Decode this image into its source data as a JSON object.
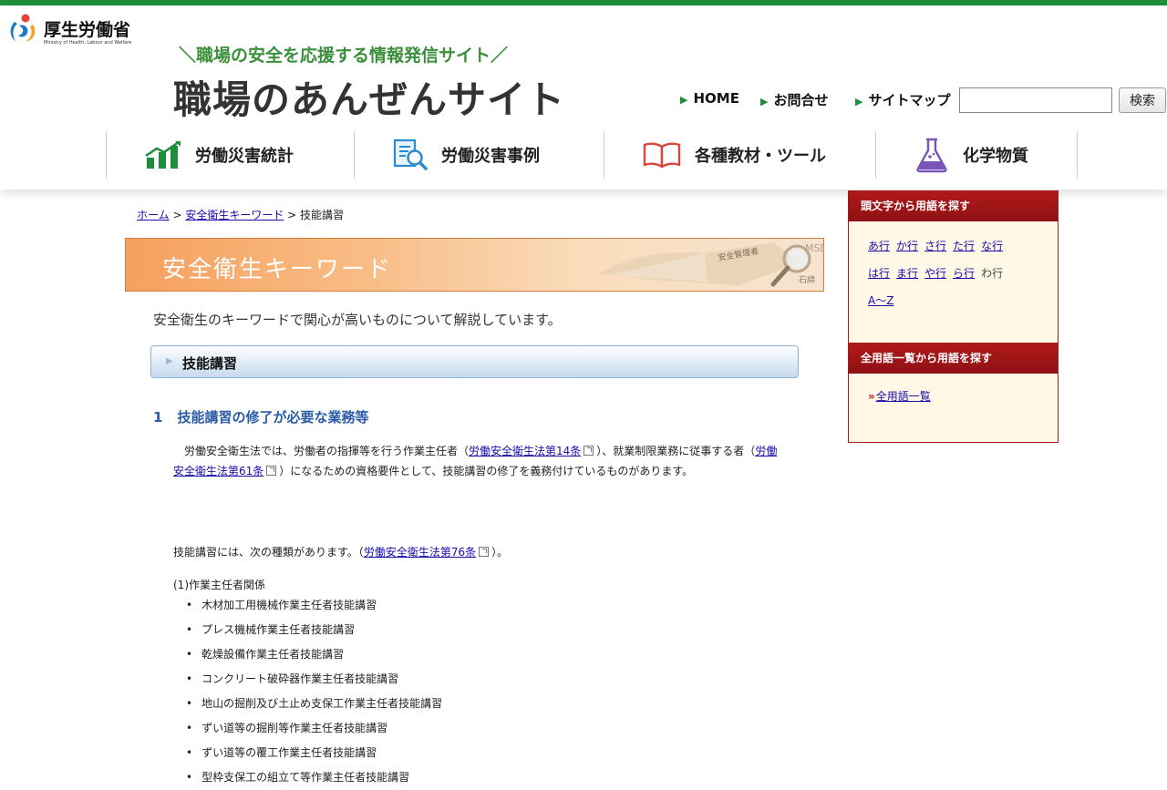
{
  "header": {
    "ministry_name": "厚生労働省",
    "ministry_en": "Ministry of Health, Labour and Welfare",
    "tagline": "＼職場の安全を応援する情報発信サイト／",
    "site_title": "職場のあんぜんサイト",
    "util_links": [
      "HOME",
      "お問合せ",
      "サイトマップ"
    ],
    "search": {
      "value": "",
      "button": "検索"
    }
  },
  "global_nav": [
    {
      "label": "労働災害統計",
      "icon": "bar-chart-icon"
    },
    {
      "label": "労働災害事例",
      "icon": "document-search-icon"
    },
    {
      "label": "各種教材・ツール",
      "icon": "open-book-icon"
    },
    {
      "label": "化学物質",
      "icon": "flask-icon"
    }
  ],
  "breadcrumb": {
    "home": "ホーム",
    "sep": " > ",
    "parent": "安全衛生キーワード",
    "current": "技能講習"
  },
  "banner": {
    "title": "安全衛生キーワード",
    "art_text_1": "安全管理者",
    "art_text_2": "MSDS",
    "art_text_3": "石綿"
  },
  "intro": "安全衛生のキーワードで関心が高いものについて解説しています。",
  "section": {
    "title": "技能講習"
  },
  "subsection": {
    "number": "1",
    "title": "技能講習の修了が必要な業務等"
  },
  "paragraph": {
    "t1": "　労働安全衛生法では、労働者の指揮等を行う作業主任者（",
    "link1": "労働安全衛生法第14条",
    "t2": "）、就業制限業務に従事する者（",
    "link2": "労働安全衛生法第61条",
    "t3": "）になるための資格要件として、技能講習の修了を義務付けているものがあります。"
  },
  "paragraph2": {
    "t1": "技能講習には、次の種類があります。（",
    "link": "労働安全衛生法第76条",
    "t2": "）。"
  },
  "category_label": "(1)作業主任者関係",
  "courses": [
    "木材加工用機械作業主任者技能講習",
    "プレス機械作業主任者技能講習",
    "乾燥設備作業主任者技能講習",
    "コンクリート破砕器作業主任者技能講習",
    "地山の掘削及び土止め支保工作業主任者技能講習",
    "ずい道等の掘削等作業主任者技能講習",
    "ずい道等の覆工作業主任者技能講習",
    "型枠支保工の組立て等作業主任者技能講習"
  ],
  "sidebar": {
    "initial_heading": "頭文字から用語を探す",
    "initials_row1": [
      "あ行",
      "か行",
      "さ行",
      "た行",
      "な行"
    ],
    "initials_row2": [
      "は行",
      "ま行",
      "や行",
      "ら行"
    ],
    "initials_plain": "わ行",
    "initials_row3": [
      "A～Z"
    ],
    "all_heading": "全用語一覧から用語を探す",
    "all_link": "全用語一覧"
  }
}
